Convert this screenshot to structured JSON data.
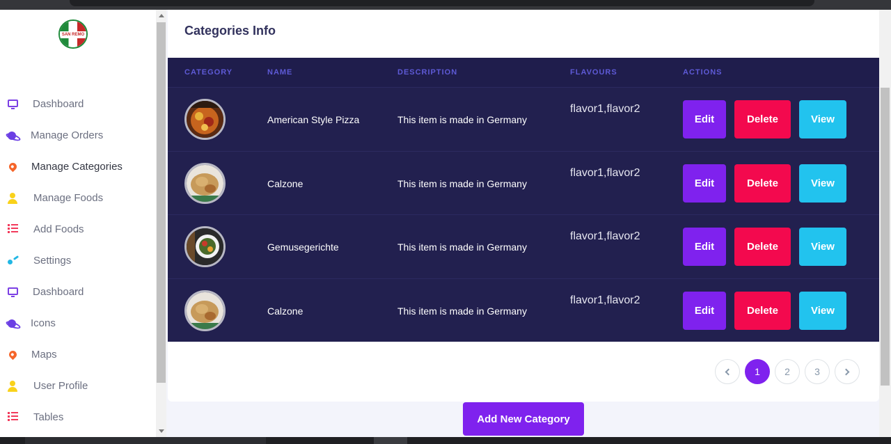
{
  "sidebar": {
    "logo_text": "SAN REMO",
    "items": [
      {
        "label": "Dashboard",
        "icon": "monitor-icon"
      },
      {
        "label": "Manage Orders",
        "icon": "planet-icon"
      },
      {
        "label": "Manage Categories",
        "icon": "pin-icon"
      },
      {
        "label": "Manage Foods",
        "icon": "user-icon"
      },
      {
        "label": "Add Foods",
        "icon": "list-icon"
      },
      {
        "label": "Settings",
        "icon": "settings-icon"
      },
      {
        "label": "Dashboard",
        "icon": "monitor-icon"
      },
      {
        "label": "Icons",
        "icon": "planet-icon"
      },
      {
        "label": "Maps",
        "icon": "pin-icon"
      },
      {
        "label": "User Profile",
        "icon": "user-icon"
      },
      {
        "label": "Tables",
        "icon": "list-icon"
      }
    ]
  },
  "card": {
    "title": "Categories Info",
    "headers": [
      "CATEGORY",
      "NAME",
      "DESCRIPTION",
      "FLAVOURS",
      "ACTIONS"
    ],
    "rows": [
      {
        "name": "American Style Pizza",
        "description": "This item is made in Germany",
        "flavours": "flavor1,flavor2",
        "image": "pizza-thumbnail"
      },
      {
        "name": "Calzone",
        "description": "This item is made in Germany",
        "flavours": "flavor1,flavor2",
        "image": "calzone-thumbnail"
      },
      {
        "name": "Gemusegerichte",
        "description": "This item is made in Germany",
        "flavours": "flavor1,flavor2",
        "image": "vegetable-dish-thumbnail"
      },
      {
        "name": "Calzone",
        "description": "This item is made in Germany",
        "flavours": "flavor1,flavor2",
        "image": "calzone-thumbnail"
      }
    ],
    "actions": {
      "edit": "Edit",
      "delete": "Delete",
      "view": "View"
    }
  },
  "pagination": {
    "pages": [
      "1",
      "2",
      "3"
    ],
    "current": "1"
  },
  "add_button": "Add New Category",
  "colors": {
    "primary": "#7f22ee",
    "danger": "#f3094e",
    "info": "#22c3ee",
    "table_bg": "#22204f",
    "title": "#32325d"
  }
}
